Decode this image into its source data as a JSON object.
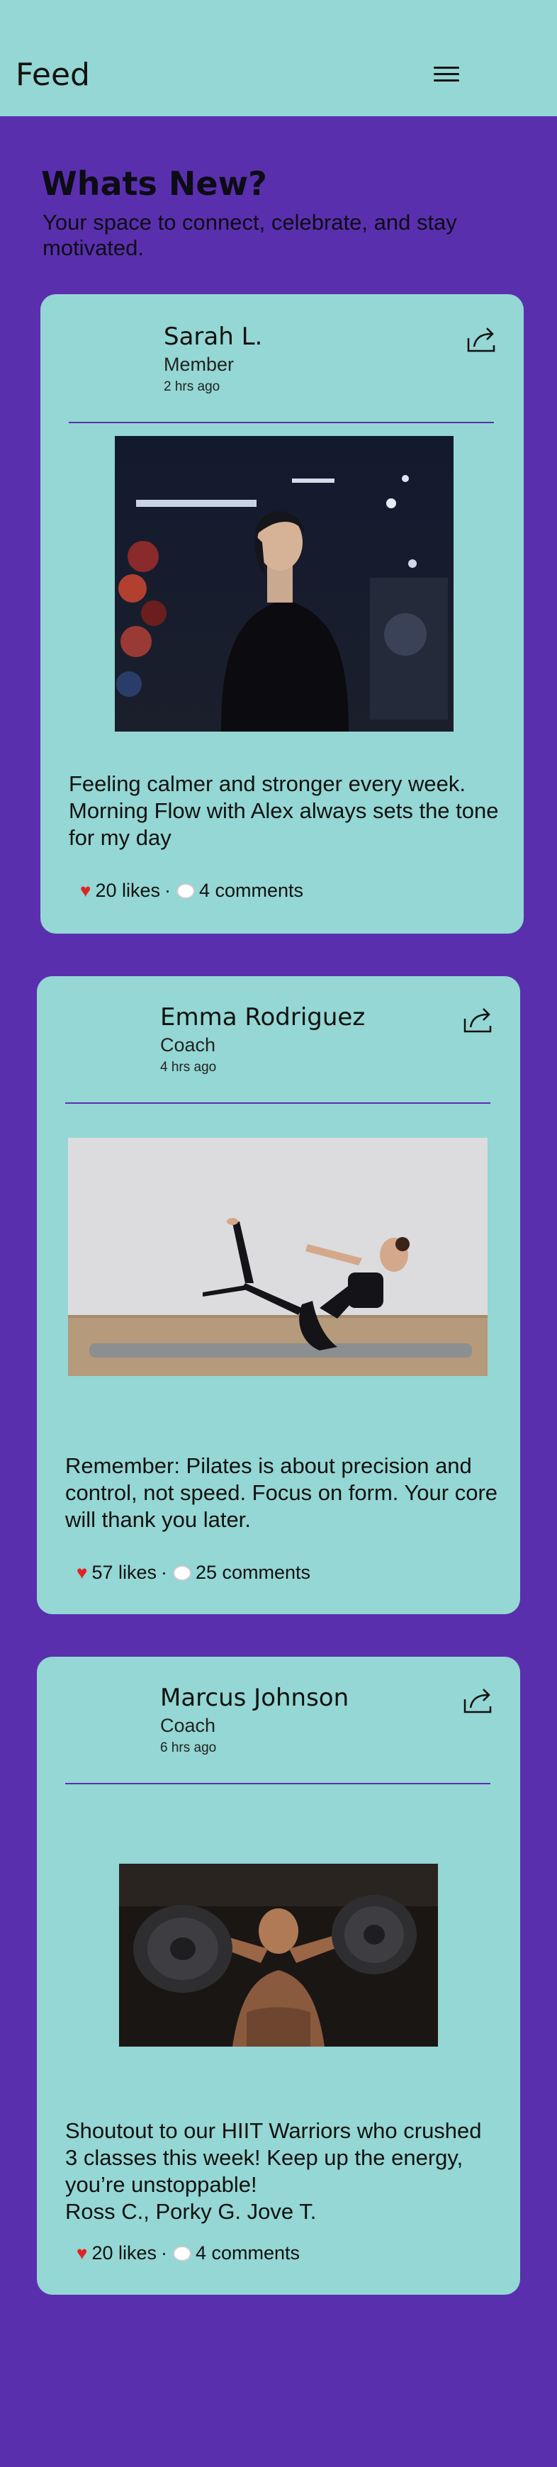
{
  "header": {
    "title": "Feed",
    "menu_icon": "hamburger-menu-icon"
  },
  "hero": {
    "title": "Whats New?",
    "subtitle": "Your space to connect, celebrate, and stay motivated."
  },
  "colors": {
    "background": "#5a2fae",
    "card": "#94d7d4",
    "heart": "#e02424"
  },
  "posts": [
    {
      "author": "Sarah L.",
      "role": "Member",
      "time": "2 hrs ago",
      "text": "Feeling calmer and stronger every week. Morning Flow with Alex always sets the tone for my day",
      "likes": "20 likes",
      "comments": "4 comments",
      "image": "woman-in-gym-photo"
    },
    {
      "author": "Emma Rodriguez",
      "role": "Coach",
      "time": "4 hrs ago",
      "text": "Remember: Pilates is about precision and control, not speed. Focus on form. Your core will thank you later.",
      "likes": "57 likes",
      "comments": "25 comments",
      "image": "pilates-pose-photo"
    },
    {
      "author": "Marcus Johnson",
      "role": "Coach",
      "time": "6 hrs ago",
      "text": "Shoutout to our HIIT Warriors who crushed 3 classes this week! Keep up the energy, you’re unstoppable!\nRoss C., Porky G. Jove T.",
      "likes": "20 likes",
      "comments": "4 comments",
      "image": "dumbbell-press-photo"
    }
  ]
}
